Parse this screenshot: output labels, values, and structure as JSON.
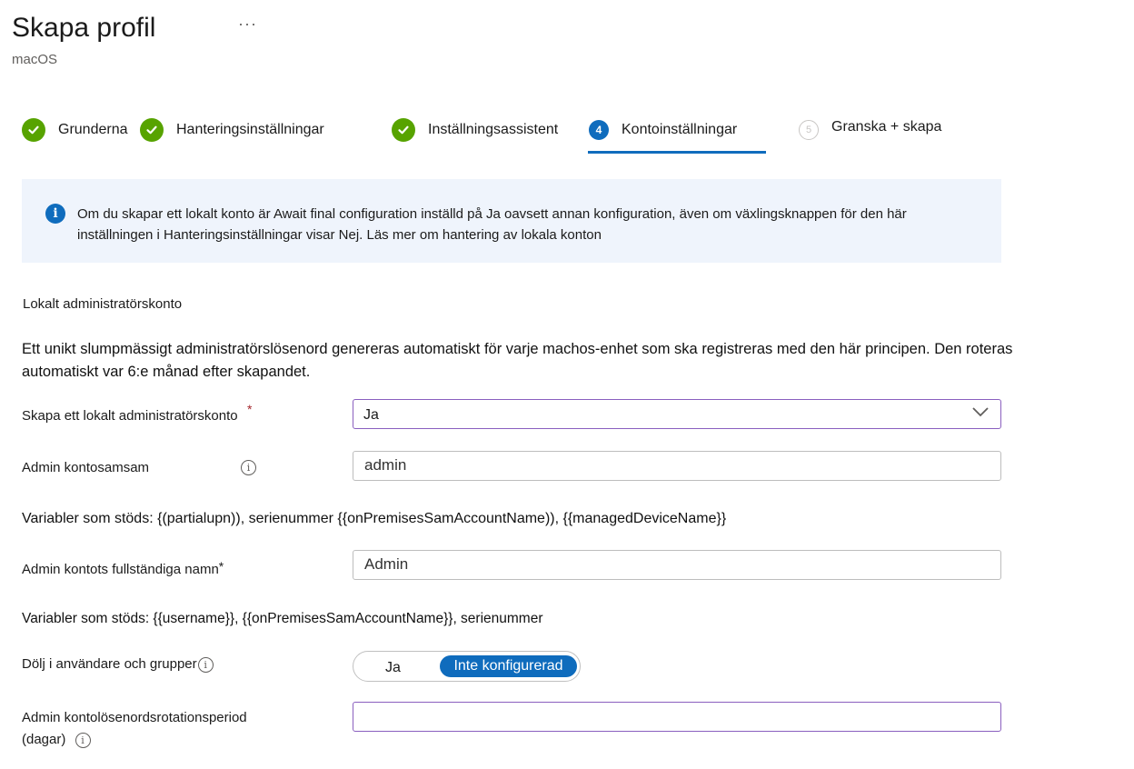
{
  "header": {
    "title": "Skapa profil",
    "more": "···",
    "subtitle": "macOS"
  },
  "steps": [
    {
      "label": "Grunderna",
      "state": "done"
    },
    {
      "label": "Hanteringsinställningar",
      "state": "done"
    },
    {
      "label": "Inställningsassistent",
      "state": "done"
    },
    {
      "label": "Kontoinställningar",
      "state": "current",
      "number": "4"
    },
    {
      "label": "Granska + skapa",
      "state": "todo",
      "number": "5"
    }
  ],
  "banner": {
    "text": "Om du skapar ett lokalt konto är Await final configuration inställd på Ja oavsett annan konfiguration, även om växlingsknappen för den här inställningen i Hanteringsinställningar visar Nej. Läs mer om hantering av lokala konton"
  },
  "section": {
    "title": "Lokalt administratörskonto",
    "description": "Ett unikt slumpmässigt administratörslösenord genereras automatiskt för varje machos-enhet som ska registreras med den här principen. Den roteras automatiskt var 6:e månad efter skapandet."
  },
  "fields": {
    "create_local_admin": {
      "label": "Skapa ett lokalt administratörskonto",
      "required_mark": "*",
      "value": "Ja"
    },
    "admin_account_name": {
      "label": "Admin kontosamsam",
      "value": "admin"
    },
    "vars1": "Variabler som stöds: {(partialupn)), serienummer {{onPremisesSamAccountName)), {{managedDeviceName}}",
    "admin_full_name": {
      "label": "Admin kontots fullständiga namn",
      "required_mark": "*",
      "value": "Admin"
    },
    "vars2": "Variabler som stöds: {{username}}, {{onPremisesSamAccountName}}, serienummer",
    "hide_in_users": {
      "label": "Dölj i användare och grupper",
      "option_off": "Ja",
      "option_on": "Inte konfigurerad"
    },
    "rotation_period": {
      "label_line1": "Admin kontolösenordsrotationsperiod",
      "label_line2": "(dagar)",
      "value": ""
    }
  },
  "colors": {
    "accent": "#0f6cbd",
    "success": "#57a300",
    "focus_border": "#8a5fbf",
    "banner_bg": "#eff4fc"
  }
}
